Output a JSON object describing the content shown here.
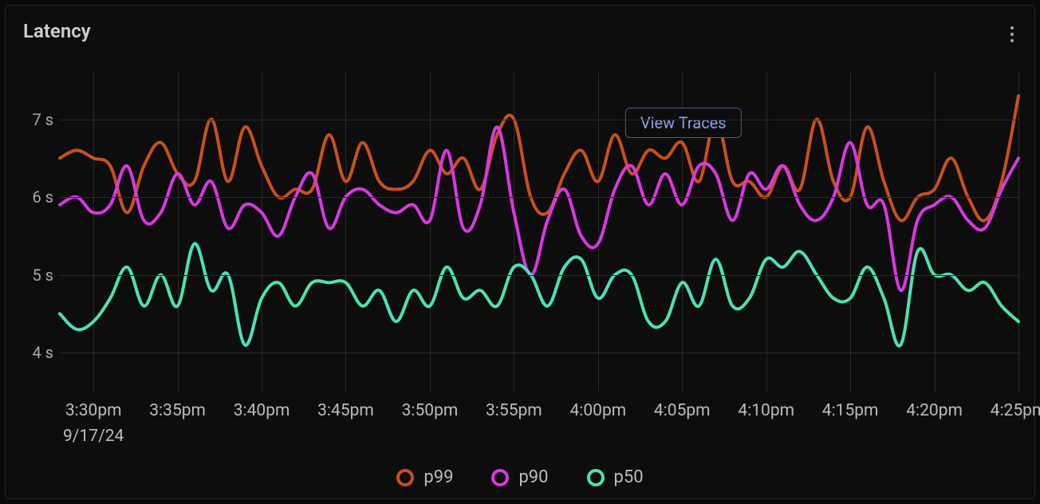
{
  "panel": {
    "title": "Latency",
    "menu_label": "more options"
  },
  "button": {
    "view_traces": "View Traces"
  },
  "legend": [
    {
      "name": "p99",
      "color": "#c8501e"
    },
    {
      "name": "p90",
      "color": "#d838e0"
    },
    {
      "name": "p50",
      "color": "#4de0b8"
    }
  ],
  "chart_data": {
    "type": "line",
    "title": "Latency",
    "xlabel": "",
    "ylabel": "",
    "y_unit": "s",
    "ylim": [
      3.5,
      7.6
    ],
    "y_ticks": [
      4,
      5,
      6,
      7
    ],
    "x_ticks": [
      "3:30pm",
      "3:35pm",
      "3:40pm",
      "3:45pm",
      "3:50pm",
      "3:55pm",
      "4:00pm",
      "4:05pm",
      "4:10pm",
      "4:15pm",
      "4:20pm",
      "4:25pm"
    ],
    "x_date": "9/17/24",
    "x": [
      "3:28pm",
      "3:29pm",
      "3:30pm",
      "3:31pm",
      "3:32pm",
      "3:33pm",
      "3:34pm",
      "3:35pm",
      "3:36pm",
      "3:37pm",
      "3:38pm",
      "3:39pm",
      "3:40pm",
      "3:41pm",
      "3:42pm",
      "3:43pm",
      "3:44pm",
      "3:45pm",
      "3:46pm",
      "3:47pm",
      "3:48pm",
      "3:49pm",
      "3:50pm",
      "3:51pm",
      "3:52pm",
      "3:53pm",
      "3:54pm",
      "3:55pm",
      "3:56pm",
      "3:57pm",
      "3:58pm",
      "3:59pm",
      "4:00pm",
      "4:01pm",
      "4:02pm",
      "4:03pm",
      "4:04pm",
      "4:05pm",
      "4:06pm",
      "4:07pm",
      "4:08pm",
      "4:09pm",
      "4:10pm",
      "4:11pm",
      "4:12pm",
      "4:13pm",
      "4:14pm",
      "4:15pm",
      "4:16pm",
      "4:17pm",
      "4:18pm",
      "4:19pm",
      "4:20pm",
      "4:21pm",
      "4:22pm",
      "4:23pm",
      "4:24pm",
      "4:25pm"
    ],
    "series": [
      {
        "name": "p99",
        "color": "#c8501e",
        "values": [
          6.5,
          6.6,
          6.5,
          6.4,
          5.8,
          6.4,
          6.7,
          6.3,
          6.2,
          7.0,
          6.2,
          6.9,
          6.4,
          6.0,
          6.1,
          6.1,
          6.8,
          6.2,
          6.7,
          6.2,
          6.1,
          6.2,
          6.6,
          6.3,
          6.5,
          6.1,
          6.8,
          7.0,
          6.0,
          5.8,
          6.3,
          6.6,
          6.2,
          6.8,
          6.3,
          6.6,
          6.5,
          6.7,
          6.2,
          7.0,
          6.2,
          6.2,
          6.0,
          6.4,
          6.1,
          7.0,
          6.2,
          6.0,
          6.9,
          6.2,
          5.7,
          6.0,
          6.1,
          6.5,
          6.0,
          5.7,
          6.2,
          7.3
        ]
      },
      {
        "name": "p90",
        "color": "#d838e0",
        "values": [
          5.9,
          6.0,
          5.8,
          5.9,
          6.4,
          5.7,
          5.8,
          6.3,
          5.9,
          6.2,
          5.6,
          5.9,
          5.8,
          5.5,
          6.0,
          6.3,
          5.6,
          6.0,
          6.1,
          5.9,
          5.8,
          5.9,
          5.7,
          6.6,
          5.6,
          5.9,
          6.9,
          5.8,
          5.0,
          5.7,
          6.1,
          5.5,
          5.4,
          6.1,
          6.4,
          5.9,
          6.3,
          5.9,
          6.4,
          6.3,
          5.7,
          6.3,
          6.1,
          6.4,
          5.9,
          5.7,
          6.0,
          6.7,
          5.9,
          5.9,
          4.8,
          5.7,
          5.9,
          6.0,
          5.7,
          5.6,
          6.1,
          6.5
        ]
      },
      {
        "name": "p50",
        "color": "#4de0b8",
        "values": [
          4.5,
          4.3,
          4.4,
          4.7,
          5.1,
          4.6,
          5.0,
          4.6,
          5.4,
          4.8,
          5.0,
          4.1,
          4.7,
          4.9,
          4.6,
          4.9,
          4.9,
          4.9,
          4.6,
          4.8,
          4.4,
          4.8,
          4.6,
          5.1,
          4.7,
          4.8,
          4.6,
          5.1,
          5.0,
          4.6,
          5.1,
          5.2,
          4.7,
          5.0,
          5.0,
          4.4,
          4.4,
          4.9,
          4.6,
          5.2,
          4.6,
          4.7,
          5.2,
          5.1,
          5.3,
          5.0,
          4.7,
          4.7,
          5.1,
          4.7,
          4.1,
          5.3,
          5.0,
          5.0,
          4.8,
          4.9,
          4.6,
          4.4
        ]
      }
    ]
  }
}
